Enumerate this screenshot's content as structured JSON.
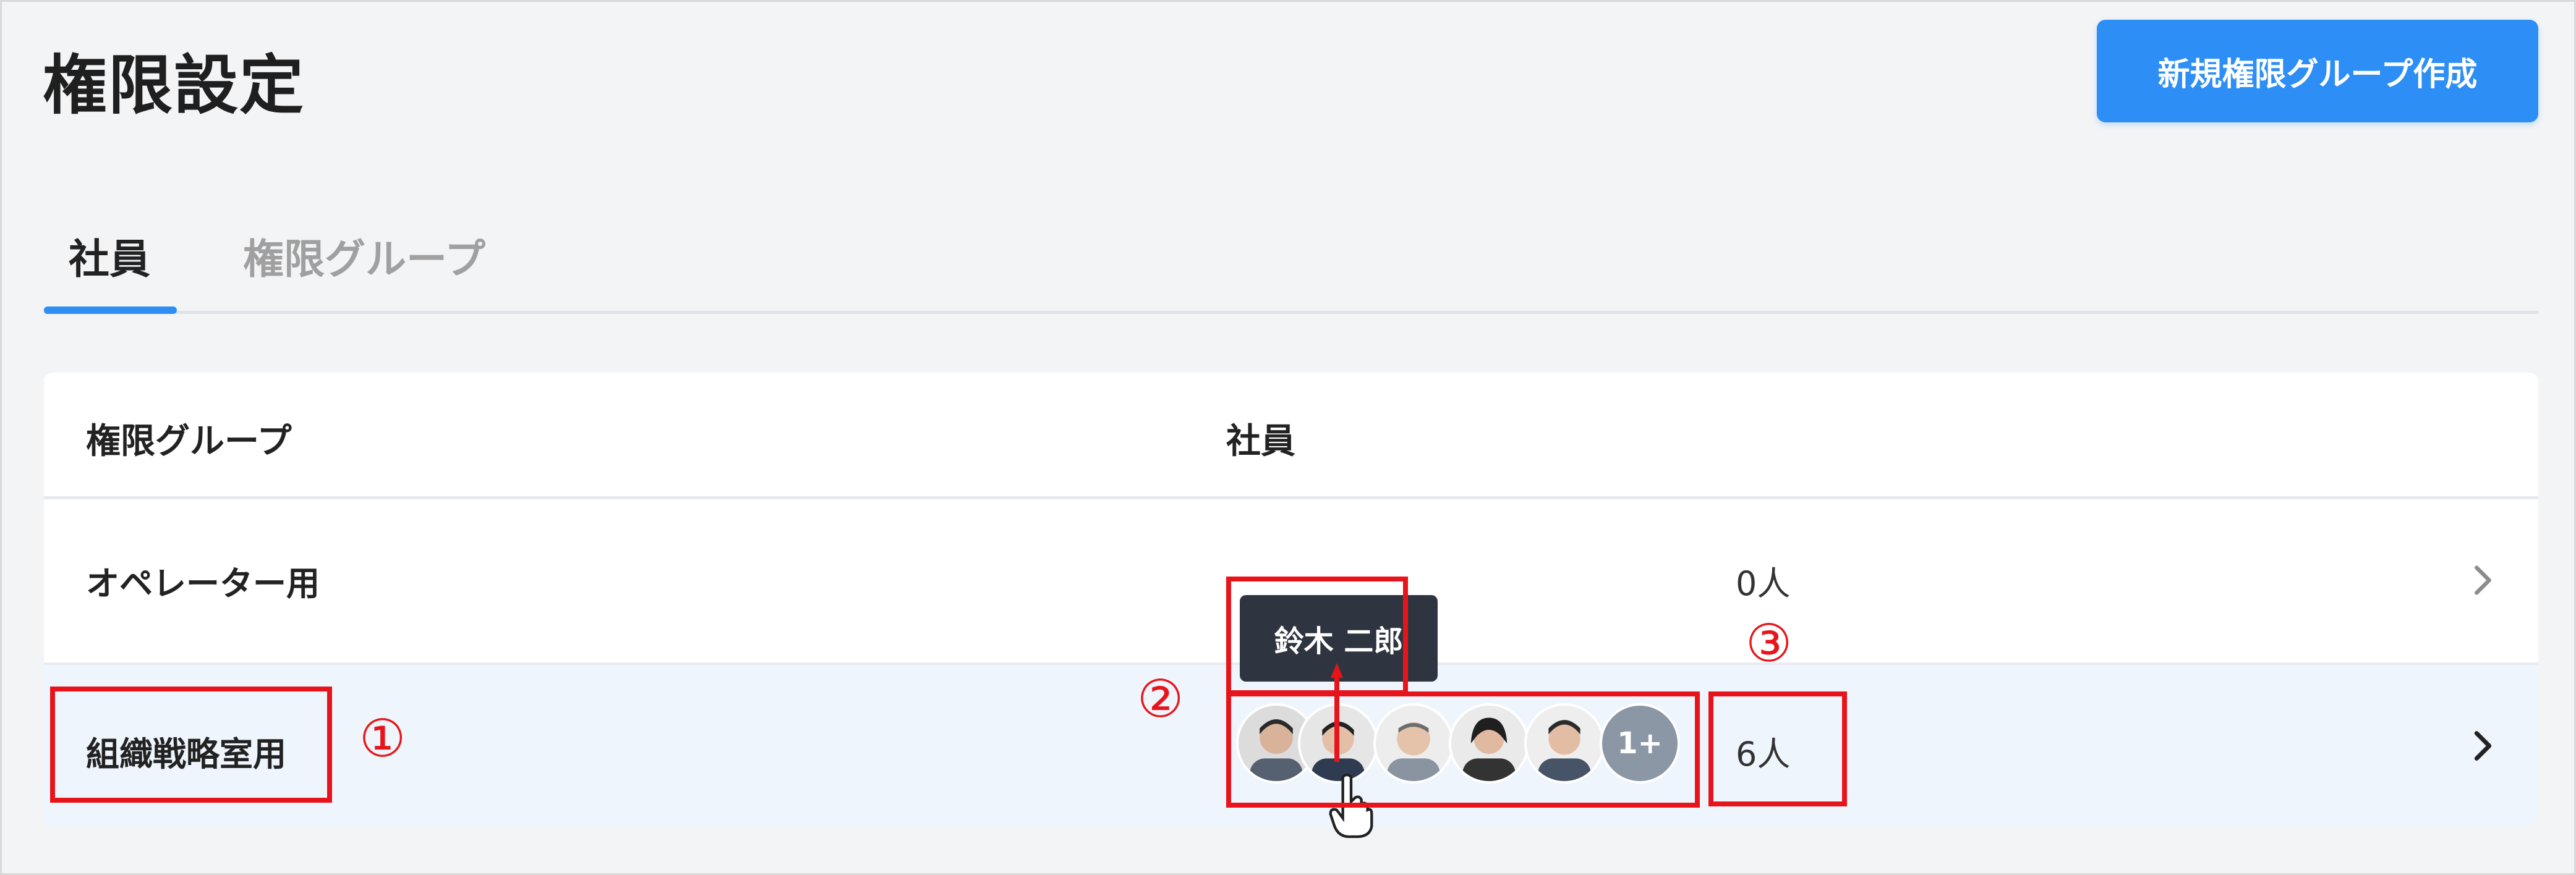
{
  "header": {
    "title": "権限設定",
    "create_button_label": "新規権限グループ作成"
  },
  "tabs": [
    {
      "label": "社員",
      "active": true
    },
    {
      "label": "権限グループ",
      "active": false
    }
  ],
  "table": {
    "columns": [
      "権限グループ",
      "社員"
    ],
    "rows": [
      {
        "group": "オペレーター用",
        "count": "0人"
      },
      {
        "group": "組織戦略室用",
        "count": "6人",
        "more_badge": "1+"
      }
    ]
  },
  "tooltip": {
    "text": "鈴木 二郎"
  },
  "annotations": [
    "①",
    "②",
    "③"
  ],
  "colors": {
    "accent": "#2d8ef5",
    "annotation": "#e8141b",
    "tooltip_bg": "#2f3540",
    "highlight_row": "#eef5fc"
  },
  "icons": [
    "chevron-right-icon",
    "avatar-icon",
    "hand-cursor-icon"
  ]
}
